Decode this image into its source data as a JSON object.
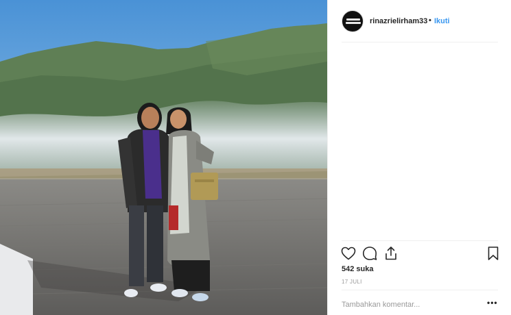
{
  "post": {
    "username": "rinazrielirham33",
    "separator": "•",
    "follow_label": "Ikuti",
    "likes_text": "542 suka",
    "date_text": "17 JULI",
    "comment_placeholder": "Tambahkan komentar...",
    "more_label": "•••"
  },
  "icons": {
    "like": "heart-icon",
    "comment": "comment-bubble-icon",
    "share": "share-upload-icon",
    "save": "bookmark-icon",
    "more": "more-options-icon"
  },
  "colors": {
    "link": "#3897f0",
    "text": "#262626",
    "muted": "#999999",
    "divider": "#efefef"
  }
}
